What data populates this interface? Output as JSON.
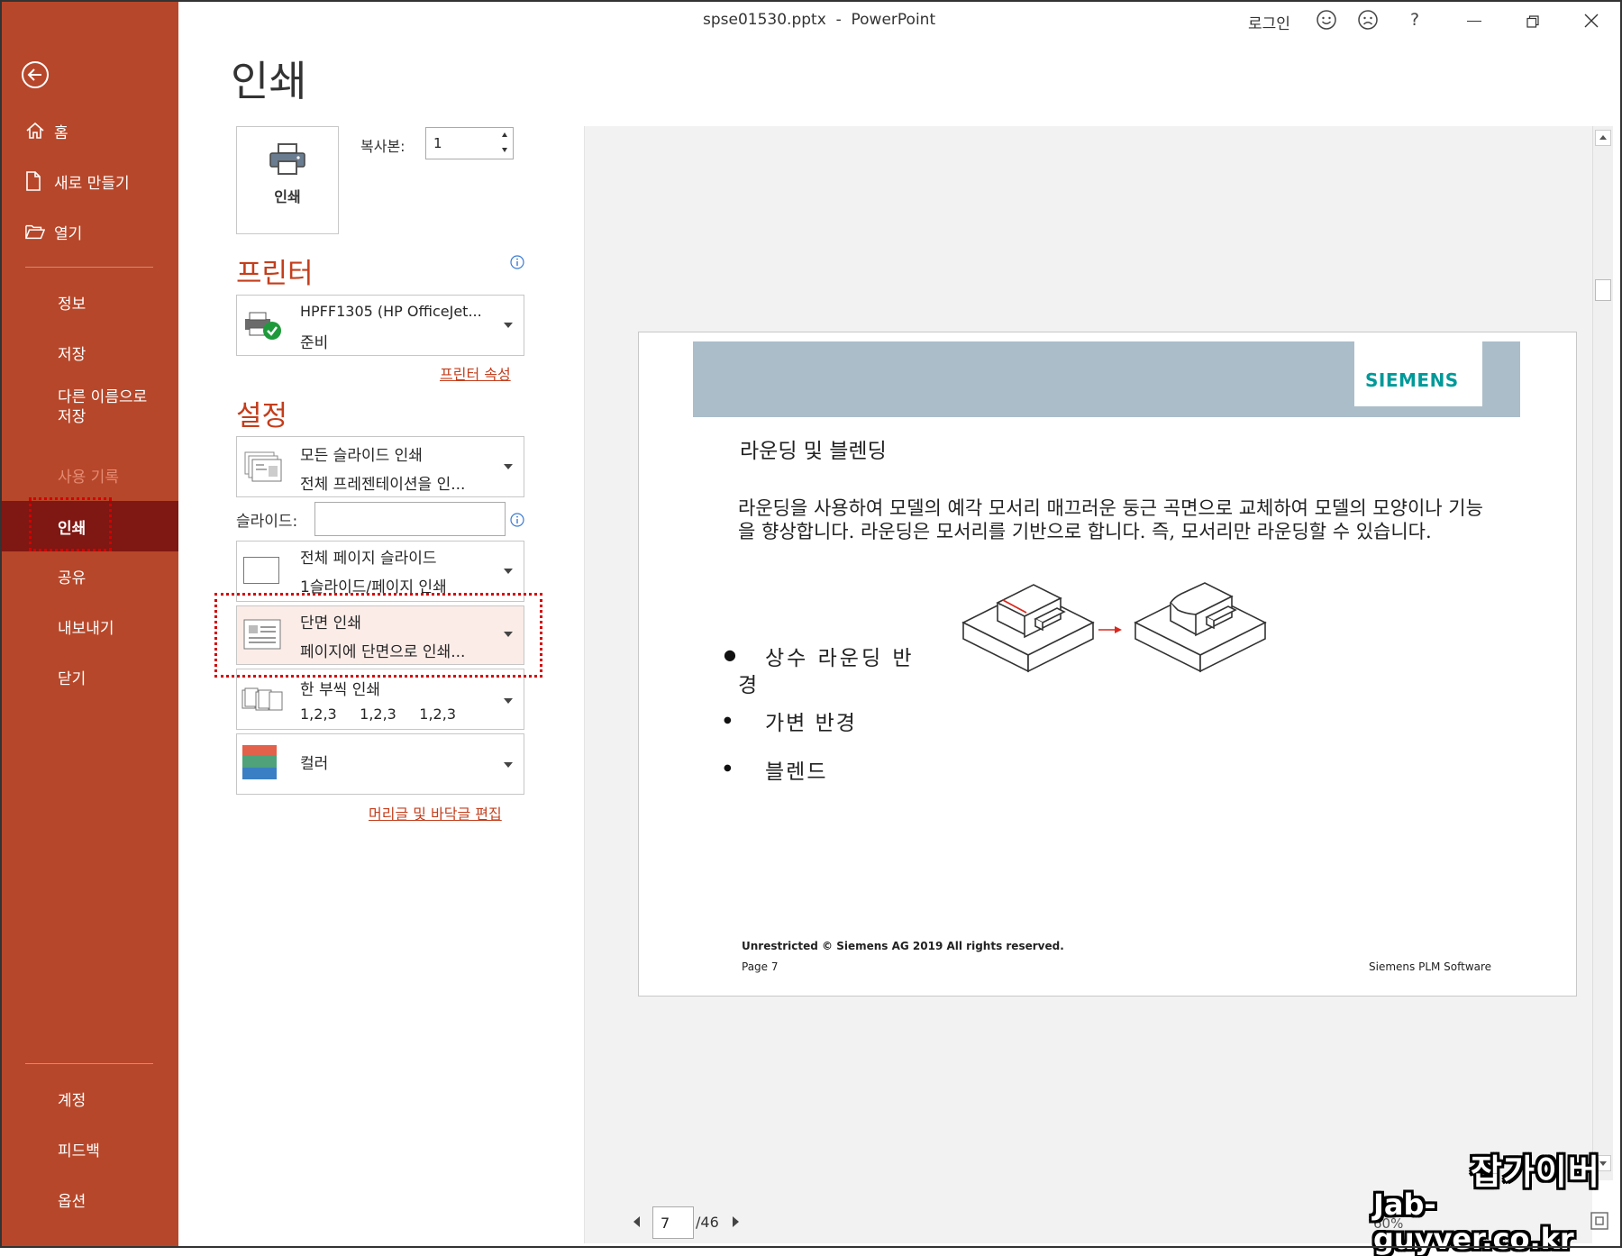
{
  "window": {
    "title": "spse01530.pptx  -  PowerPoint",
    "signin": "로그인",
    "help": "?"
  },
  "sidebar": {
    "home": "홈",
    "new": "새로 만들기",
    "open": "열기",
    "info": "정보",
    "save": "저장",
    "save_as_1": "다른 이름으로",
    "save_as_2": "저장",
    "history": "사용 기록",
    "print": "인쇄",
    "share": "공유",
    "export": "내보내기",
    "close": "닫기",
    "account": "계정",
    "feedback": "피드백",
    "options": "옵션"
  },
  "print": {
    "heading": "인쇄",
    "print_button": "인쇄",
    "copies_label": "복사본:",
    "copies_value": "1",
    "printer_section": "프린터",
    "printer_name": "HPFF1305 (HP OfficeJet...",
    "printer_status": "준비",
    "printer_properties": "프린터 속성",
    "settings_section": "설정",
    "slides_opt_1": "모든 슬라이드 인쇄",
    "slides_opt_2": "전체 프레젠테이션을 인...",
    "slides_label": "슬라이드:",
    "slides_value": "",
    "layout_opt_1": "전체 페이지 슬라이드",
    "layout_opt_2": "1슬라이드/페이지 인쇄",
    "sides_opt_1": "단면 인쇄",
    "sides_opt_2": "페이지에 단면으로 인쇄...",
    "collate_opt_1": "한 부씩 인쇄",
    "collate_opt_2": "1,2,3     1,2,3     1,2,3",
    "color_opt": "컬러",
    "header_footer_link": "머리글 및 바닥글 편집"
  },
  "preview": {
    "brand": "SIEMENS",
    "slide_title": "라운딩 및 블렌딩",
    "paragraph": "라운딩을 사용하여 모델의 예각 모서리 매끄러운 둥근 곡면으로 교체하여 모델의 모양이나 기능을 향상합니다. 라운딩은 모서리를 기반으로 합니다. 즉, 모서리만 라운딩할 수 있습니다.",
    "bullet_1a": "상수 라운딩 반",
    "bullet_1b": "경",
    "bullet_2": "가변 반경",
    "bullet_3": "블렌드",
    "footer_left": "Unrestricted © Siemens AG 2019 All rights reserved.",
    "footer_page": "Page 7",
    "footer_right": "Siemens PLM Software",
    "page_input": "7",
    "page_total": "/46",
    "zoom": "60%"
  },
  "watermark": {
    "line1": "잡가이버",
    "line2": "Jab-guyver.co.kr"
  },
  "colors": {
    "sidebar": "#b7472a",
    "sidebar_selected": "#7f1712",
    "accent": "#c43e1c",
    "highlight_box": "#d40000",
    "siemens_teal": "#009999",
    "banner": "#abbdc9"
  }
}
